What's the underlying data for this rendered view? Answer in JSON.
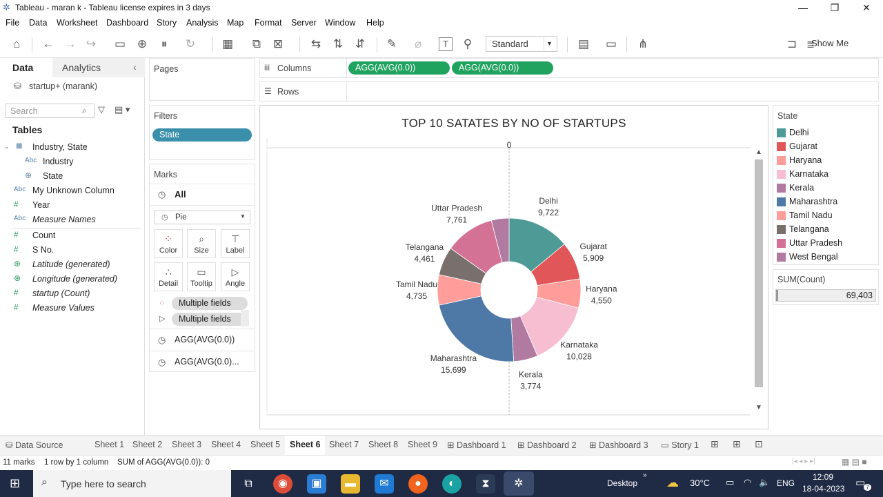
{
  "window": {
    "title": "Tableau - maran k - Tableau license expires in 3 days",
    "min": "—",
    "max": "❐",
    "close": "✕"
  },
  "menu": [
    "File",
    "Data",
    "Worksheet",
    "Dashboard",
    "Story",
    "Analysis",
    "Map",
    "Format",
    "Server",
    "Window",
    "Help"
  ],
  "toolbar": {
    "fit_select": "Standard",
    "show_me": "Show Me"
  },
  "data_pane": {
    "tab_data": "Data",
    "tab_analytics": "Analytics",
    "datasource": "startup+ (marank)",
    "search_placeholder": "Search",
    "tables_label": "Tables",
    "fields": [
      {
        "icon": "▦",
        "label": "Industry, State"
      },
      {
        "icon": "Abc",
        "label": "Industry"
      },
      {
        "icon": "⊕",
        "label": "State"
      },
      {
        "icon": "Abc",
        "label": "My Unknown Column"
      },
      {
        "icon": "#",
        "label": "Year"
      },
      {
        "icon": "Abc",
        "label": "Measure Names"
      },
      {
        "icon": "#",
        "label": "Count"
      },
      {
        "icon": "#",
        "label": "S No."
      },
      {
        "icon": "⊕",
        "label": "Latitude (generated)"
      },
      {
        "icon": "⊕",
        "label": "Longitude (generated)"
      },
      {
        "icon": "#",
        "label": "startup (Count)"
      },
      {
        "icon": "#",
        "label": "Measure Values"
      }
    ]
  },
  "pages": {
    "header": "Pages"
  },
  "filters": {
    "header": "Filters",
    "pill": "State"
  },
  "marks": {
    "header": "Marks",
    "all": "All",
    "mark_type": "Pie",
    "buttons": [
      "Color",
      "Size",
      "Label",
      "Detail",
      "Tooltip",
      "Angle"
    ],
    "field_pill_1": "Multiple fields",
    "field_pill_2": "Multiple fields",
    "agg_1": "AGG(AVG(0.0))",
    "agg_2": "AGG(AVG(0.0)..."
  },
  "shelves": {
    "columns_label": "Columns",
    "rows_label": "Rows",
    "col_pill_1": "AGG(AVG(0.0))",
    "col_pill_2": "AGG(AVG(0.0))"
  },
  "chart_data": {
    "type": "pie",
    "title": "TOP 10 SATATES BY NO OF STARTUPS",
    "axis_top_tick": "0",
    "categories": [
      "Delhi",
      "Gujarat",
      "Haryana",
      "Karnataka",
      "Kerala",
      "Maharashtra",
      "Tamil Nadu",
      "Telangana",
      "Uttar Pradesh",
      "West Bengal"
    ],
    "values": [
      9722,
      5909,
      4550,
      10028,
      3774,
      15699,
      4735,
      4461,
      7761,
      2764
    ],
    "value_labels": [
      "9,722",
      "5,909",
      "4,550",
      "10,028",
      "3,774",
      "15,699",
      "4,735",
      "4,461",
      "7,761",
      ""
    ],
    "colors": [
      "#4e9a96",
      "#e15759",
      "#ff9d9a",
      "#f7bed1",
      "#b07aa1",
      "#4e79a7",
      "#ff9d9a",
      "#79706e",
      "#d37295",
      "#b07aa1"
    ],
    "donut": true
  },
  "legend": {
    "title": "State",
    "items": [
      "Delhi",
      "Gujarat",
      "Haryana",
      "Karnataka",
      "Kerala",
      "Maharashtra",
      "Tamil Nadu",
      "Telangana",
      "Uttar Pradesh",
      "West Bengal"
    ],
    "colors": [
      "#4e9a96",
      "#e15759",
      "#ff9d9a",
      "#f7bed1",
      "#b07aa1",
      "#4e79a7",
      "#ff9d9a",
      "#79706e",
      "#d37295",
      "#b07aa1"
    ]
  },
  "sum_card": {
    "title": "SUM(Count)",
    "value": "69,403"
  },
  "sheet_tabs": [
    "Data Source",
    "Sheet 1",
    "Sheet 2",
    "Sheet 3",
    "Sheet 4",
    "Sheet 5",
    "Sheet 6",
    "Sheet 7",
    "Sheet 8",
    "Sheet 9",
    "Dashboard 1",
    "Dashboard 2",
    "Dashboard 3",
    "Story 1"
  ],
  "active_tab": "Sheet 6",
  "status": {
    "marks": "11 marks",
    "dims": "1 row by 1 column",
    "sum": "SUM of AGG(AVG(0.0)): 0"
  },
  "taskbar": {
    "search_placeholder": "Type here to search",
    "desktop": "Desktop",
    "weather": "30°C",
    "lang": "ENG",
    "time": "12:09",
    "date": "18-04-2023",
    "notif_count": "7"
  }
}
